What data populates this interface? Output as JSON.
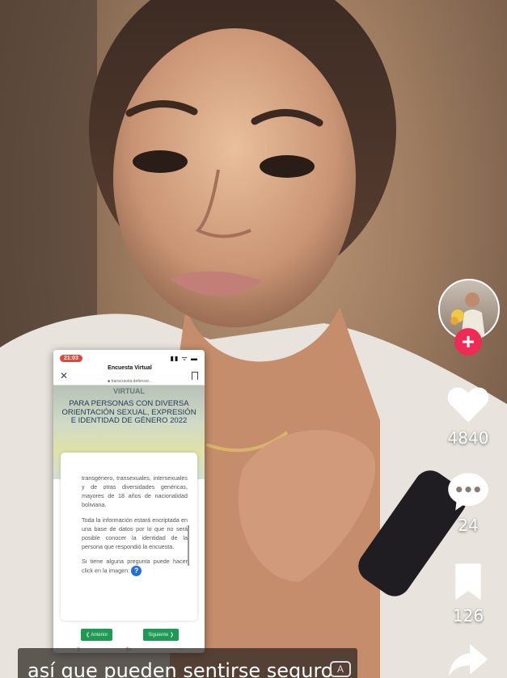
{
  "phone": {
    "time": "21:03",
    "signal": "▮▮ ᯤ ▬",
    "title": "Encuesta Virtual",
    "url": "■ transcuesta.defensor...",
    "banner_cut": "VIRTUAL",
    "banner_heading": "PARA PERSONAS CON DIVERSA ORIENTACIÓN SEXUAL, EXPRESIÓN E IDENTIDAD DE GÉNERO 2022",
    "paragraph_1": "transgénero, transexuales, intersexuales y de otras diversidades genéricas, mayores de 18 años de nacionalidad boliviana.",
    "paragraph_2": "Toda la información estará encriptada en una base de datos por lo que no será posible conocer la identidad de la persona que respondió la encuesta.",
    "paragraph_3": "Si tiene alguna pregunta puede hacer click en la imagen:",
    "help_glyph": "?",
    "prev_label": "❮ Anterior",
    "next_label": "Siguiente ❯",
    "bottom_icons": [
      "⇪",
      "↻",
      "⋯"
    ]
  },
  "rail": {
    "follow_glyph": "+",
    "likes": "4840",
    "comments": "24",
    "saves": "126"
  },
  "caption": {
    "text": "así que pueden sentirse seguro",
    "icon_glyph": "A"
  },
  "icons": {
    "follow": "plus-icon",
    "like": "heart-icon",
    "comment": "comment-bubble-icon",
    "save": "bookmark-icon",
    "share": "share-arrow-icon",
    "close": "close-icon",
    "help": "question-icon",
    "translate": "translate-icon"
  },
  "colors": {
    "follow": "#ee2a55",
    "time_pill": "#e2453c",
    "nav_button": "#1f9a55",
    "help_icon": "#1e6fd9"
  }
}
